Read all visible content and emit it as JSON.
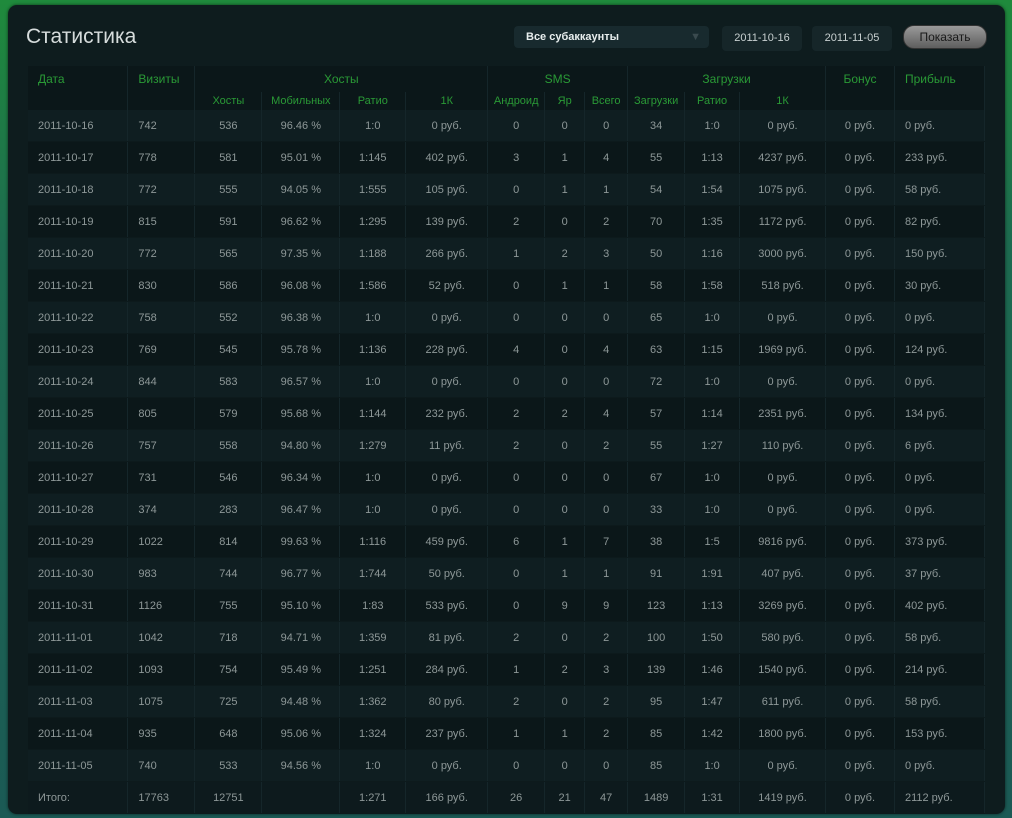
{
  "header": {
    "title": "Статистика",
    "subaccount": "Все субаккаунты",
    "date_from": "2011-10-16",
    "date_to": "2011-11-05",
    "show_button": "Показать"
  },
  "columns": {
    "group": [
      "Дата",
      "Визиты",
      "Хосты",
      "SMS",
      "Загрузки",
      "Бонус",
      "Прибыль"
    ],
    "sub": [
      "Хосты",
      "Мобильных",
      "Ратио",
      "1К",
      "Андроид",
      "Яр",
      "Всего",
      "Загрузки",
      "Ратио",
      "1К"
    ]
  },
  "rows": [
    [
      "2011-10-16",
      "742",
      "536",
      "96.46 %",
      "1:0",
      "0 руб.",
      "0",
      "0",
      "0",
      "34",
      "1:0",
      "0 руб.",
      "0 руб.",
      "0 руб."
    ],
    [
      "2011-10-17",
      "778",
      "581",
      "95.01 %",
      "1:145",
      "402 руб.",
      "3",
      "1",
      "4",
      "55",
      "1:13",
      "4237 руб.",
      "0 руб.",
      "233 руб."
    ],
    [
      "2011-10-18",
      "772",
      "555",
      "94.05 %",
      "1:555",
      "105 руб.",
      "0",
      "1",
      "1",
      "54",
      "1:54",
      "1075 руб.",
      "0 руб.",
      "58 руб."
    ],
    [
      "2011-10-19",
      "815",
      "591",
      "96.62 %",
      "1:295",
      "139 руб.",
      "2",
      "0",
      "2",
      "70",
      "1:35",
      "1172 руб.",
      "0 руб.",
      "82 руб."
    ],
    [
      "2011-10-20",
      "772",
      "565",
      "97.35 %",
      "1:188",
      "266 руб.",
      "1",
      "2",
      "3",
      "50",
      "1:16",
      "3000 руб.",
      "0 руб.",
      "150 руб."
    ],
    [
      "2011-10-21",
      "830",
      "586",
      "96.08 %",
      "1:586",
      "52 руб.",
      "0",
      "1",
      "1",
      "58",
      "1:58",
      "518 руб.",
      "0 руб.",
      "30 руб."
    ],
    [
      "2011-10-22",
      "758",
      "552",
      "96.38 %",
      "1:0",
      "0 руб.",
      "0",
      "0",
      "0",
      "65",
      "1:0",
      "0 руб.",
      "0 руб.",
      "0 руб."
    ],
    [
      "2011-10-23",
      "769",
      "545",
      "95.78 %",
      "1:136",
      "228 руб.",
      "4",
      "0",
      "4",
      "63",
      "1:15",
      "1969 руб.",
      "0 руб.",
      "124 руб."
    ],
    [
      "2011-10-24",
      "844",
      "583",
      "96.57 %",
      "1:0",
      "0 руб.",
      "0",
      "0",
      "0",
      "72",
      "1:0",
      "0 руб.",
      "0 руб.",
      "0 руб."
    ],
    [
      "2011-10-25",
      "805",
      "579",
      "95.68 %",
      "1:144",
      "232 руб.",
      "2",
      "2",
      "4",
      "57",
      "1:14",
      "2351 руб.",
      "0 руб.",
      "134 руб."
    ],
    [
      "2011-10-26",
      "757",
      "558",
      "94.80 %",
      "1:279",
      "11 руб.",
      "2",
      "0",
      "2",
      "55",
      "1:27",
      "110 руб.",
      "0 руб.",
      "6 руб."
    ],
    [
      "2011-10-27",
      "731",
      "546",
      "96.34 %",
      "1:0",
      "0 руб.",
      "0",
      "0",
      "0",
      "67",
      "1:0",
      "0 руб.",
      "0 руб.",
      "0 руб."
    ],
    [
      "2011-10-28",
      "374",
      "283",
      "96.47 %",
      "1:0",
      "0 руб.",
      "0",
      "0",
      "0",
      "33",
      "1:0",
      "0 руб.",
      "0 руб.",
      "0 руб."
    ],
    [
      "2011-10-29",
      "1022",
      "814",
      "99.63 %",
      "1:116",
      "459 руб.",
      "6",
      "1",
      "7",
      "38",
      "1:5",
      "9816 руб.",
      "0 руб.",
      "373 руб."
    ],
    [
      "2011-10-30",
      "983",
      "744",
      "96.77 %",
      "1:744",
      "50 руб.",
      "0",
      "1",
      "1",
      "91",
      "1:91",
      "407 руб.",
      "0 руб.",
      "37 руб."
    ],
    [
      "2011-10-31",
      "1126",
      "755",
      "95.10 %",
      "1:83",
      "533 руб.",
      "0",
      "9",
      "9",
      "123",
      "1:13",
      "3269 руб.",
      "0 руб.",
      "402 руб."
    ],
    [
      "2011-11-01",
      "1042",
      "718",
      "94.71 %",
      "1:359",
      "81 руб.",
      "2",
      "0",
      "2",
      "100",
      "1:50",
      "580 руб.",
      "0 руб.",
      "58 руб."
    ],
    [
      "2011-11-02",
      "1093",
      "754",
      "95.49 %",
      "1:251",
      "284 руб.",
      "1",
      "2",
      "3",
      "139",
      "1:46",
      "1540 руб.",
      "0 руб.",
      "214 руб."
    ],
    [
      "2011-11-03",
      "1075",
      "725",
      "94.48 %",
      "1:362",
      "80 руб.",
      "2",
      "0",
      "2",
      "95",
      "1:47",
      "611 руб.",
      "0 руб.",
      "58 руб."
    ],
    [
      "2011-11-04",
      "935",
      "648",
      "95.06 %",
      "1:324",
      "237 руб.",
      "1",
      "1",
      "2",
      "85",
      "1:42",
      "1800 руб.",
      "0 руб.",
      "153 руб."
    ],
    [
      "2011-11-05",
      "740",
      "533",
      "94.56 %",
      "1:0",
      "0 руб.",
      "0",
      "0",
      "0",
      "85",
      "1:0",
      "0 руб.",
      "0 руб.",
      "0 руб."
    ]
  ],
  "total": [
    "Итого:",
    "17763",
    "12751",
    "",
    "1:271",
    "166 руб.",
    "26",
    "21",
    "47",
    "1489",
    "1:31",
    "1419 руб.",
    "0 руб.",
    "2112 руб."
  ]
}
